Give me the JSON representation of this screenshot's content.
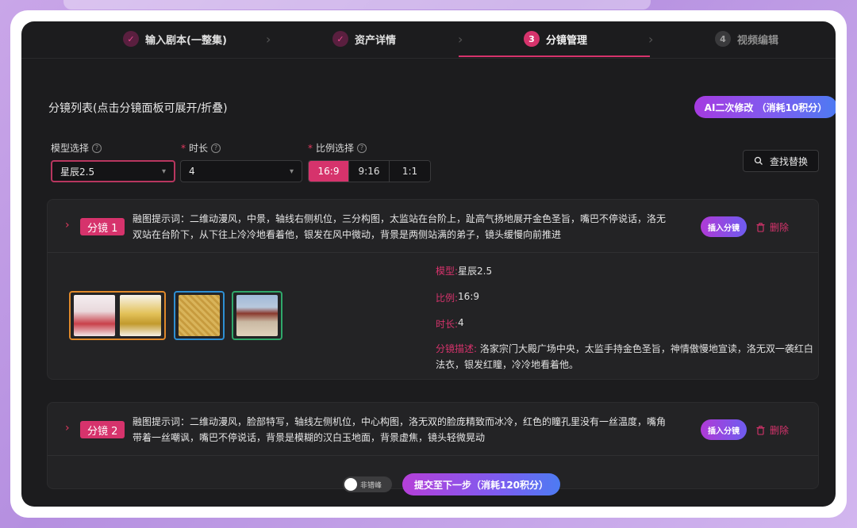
{
  "stepper": {
    "steps": [
      {
        "label": "输入剧本(一整集)",
        "marker": "✓",
        "state": "done"
      },
      {
        "label": "资产详情",
        "marker": "✓",
        "state": "done"
      },
      {
        "label": "分镜管理",
        "marker": "3",
        "state": "active"
      },
      {
        "label": "视频编辑",
        "marker": "4",
        "state": "todo"
      }
    ]
  },
  "list": {
    "title": "分镜列表(点击分镜面板可展开/折叠)",
    "ai_button": "AI二次修改 （消耗10积分）"
  },
  "form": {
    "model_label": "模型选择",
    "model_value": "星辰2.5",
    "duration_label": "时长",
    "duration_value": "4",
    "ratio_label": "比例选择",
    "ratio_options": [
      "16:9",
      "9:16",
      "1:1"
    ],
    "ratio_selected": "16:9",
    "find_replace": "查找替换"
  },
  "shots": [
    {
      "badge": "分镜 1",
      "prompt": "融图提示词：二维动漫风，中景，轴线右侧机位，三分构图，太监站在台阶上，趾高气扬地展开金色圣旨，嘴巴不停说话，洛无双站在台阶下，从下往上冷冷地看着他，银发在风中微动，背景是两侧站满的弟子，镜头缓慢向前推进",
      "insert_label": "插入分镜",
      "delete_label": "删除",
      "details": {
        "model_key": "模型:",
        "model_val": "星辰2.5",
        "ratio_key": "比例:",
        "ratio_val": "16:9",
        "duration_key": "时长:",
        "duration_val": "4",
        "desc_key": "分镜描述:",
        "desc_val": "洛家宗门大殿广场中央，太监手持金色圣旨，神情傲慢地宣读，洛无双一袭红白法衣，银发红瞳，冷冷地看着他。"
      }
    },
    {
      "badge": "分镜 2",
      "prompt": "融图提示词：二维动漫风，脸部特写，轴线左侧机位，中心构图，洛无双的脸庞精致而冰冷，红色的瞳孔里没有一丝温度，嘴角带着一丝嘲讽，嘴巴不停说话，背景是模糊的汉白玉地面，背景虚焦，镜头轻微晃动",
      "insert_label": "插入分镜",
      "delete_label": "删除"
    }
  ],
  "bottom": {
    "toggle_label": "非错峰",
    "submit": "提交至下一步（消耗120积分）"
  },
  "colors": {
    "accent": "#d6336c",
    "background": "#1c1c1e",
    "panel": "#232325"
  }
}
